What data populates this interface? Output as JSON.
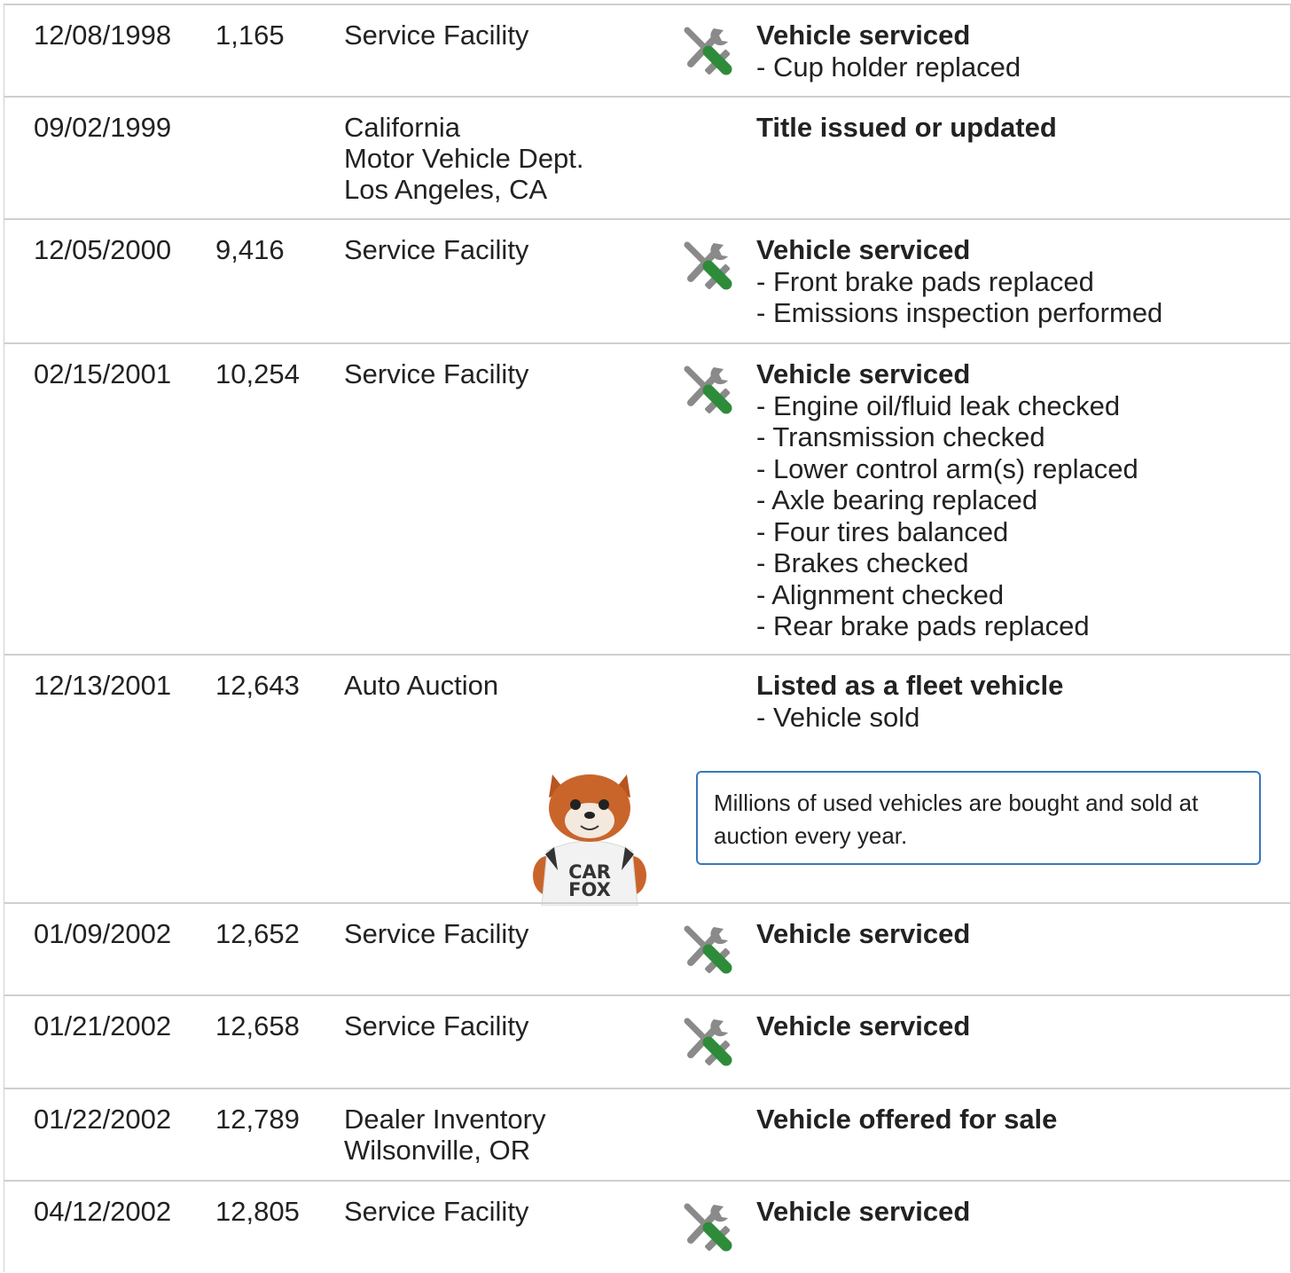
{
  "records": [
    {
      "date": "12/08/1998",
      "mileage": "1,165",
      "source": [
        "Service Facility"
      ],
      "service_icon": "wrench-screwdriver-icon",
      "headline": "Vehicle serviced",
      "details": [
        "Cup holder replaced"
      ]
    },
    {
      "date": "09/02/1999",
      "mileage": "",
      "source": [
        "California",
        "Motor Vehicle Dept.",
        "Los Angeles, CA"
      ],
      "headline": "Title issued or updated",
      "details": []
    },
    {
      "date": "12/05/2000",
      "mileage": "9,416",
      "source": [
        "Service Facility"
      ],
      "service_icon": "wrench-screwdriver-icon",
      "headline": "Vehicle serviced",
      "details": [
        "Front brake pads replaced",
        "Emissions inspection performed"
      ]
    },
    {
      "date": "02/15/2001",
      "mileage": "10,254",
      "source": [
        "Service Facility"
      ],
      "service_icon": "wrench-screwdriver-icon",
      "headline": "Vehicle serviced",
      "details": [
        "Engine oil/fluid leak checked",
        "Transmission checked",
        "Lower control arm(s) replaced",
        "Axle bearing replaced",
        "Four tires balanced",
        "Brakes checked",
        "Alignment checked",
        "Rear brake pads replaced"
      ]
    },
    {
      "date": "12/13/2001",
      "mileage": "12,643",
      "source": [
        "Auto Auction"
      ],
      "headline": "Listed as a fleet vehicle",
      "details": [
        "Vehicle sold"
      ],
      "callout": "Millions of used vehicles are bought and sold at auction every year.",
      "mascot_text": [
        "CAR",
        "FOX"
      ]
    },
    {
      "date": "01/09/2002",
      "mileage": "12,652",
      "source": [
        "Service Facility"
      ],
      "service_icon": "wrench-screwdriver-icon",
      "headline": "Vehicle serviced",
      "details": []
    },
    {
      "date": "01/21/2002",
      "mileage": "12,658",
      "source": [
        "Service Facility"
      ],
      "service_icon": "wrench-screwdriver-icon",
      "headline": "Vehicle serviced",
      "details": []
    },
    {
      "date": "01/22/2002",
      "mileage": "12,789",
      "source": [
        "Dealer Inventory",
        "Wilsonville, OR"
      ],
      "headline": "Vehicle offered for sale",
      "details": []
    },
    {
      "date": "04/12/2002",
      "mileage": "12,805",
      "source": [
        "Service Facility"
      ],
      "service_icon": "wrench-screwdriver-icon",
      "headline": "Vehicle serviced",
      "details": []
    }
  ],
  "colors": {
    "icon_gray": "#8a8a8a",
    "icon_green": "#2e8b3a",
    "callout_border": "#3777bc",
    "row_border": "#cfcfcf"
  }
}
